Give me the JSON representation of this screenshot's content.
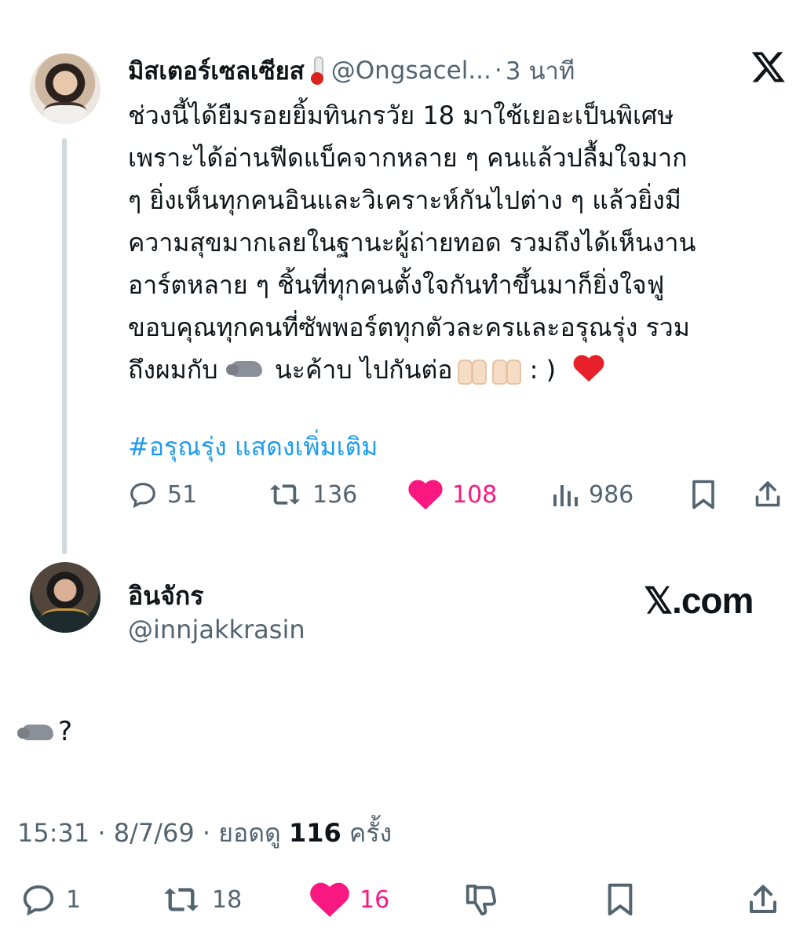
{
  "tweet": {
    "author_name": "มิสเตอร์เซลเซียส",
    "author_handle": "@Ongsacel...",
    "time_ago": "3 นาที",
    "separator": "·",
    "body_lines": [
      "ช่วงนี้ได้ยืมรอยยิ้มทินกรวัย 18 มาใช้เยอะเป็นพิเศษ",
      "เพราะได้อ่านฟีดแบ็คจากหลาย ๆ คนแล้วปลื้มใจมาก",
      "ๆ ยิ่งเห็นทุกคนอินและวิเคราะห์กันไปต่าง ๆ แล้วยิ่งมี",
      "ความสุขมากเลยในฐานะผู้ถ่ายทอด รวมถึงได้เห็นงาน",
      "อาร์ตหลาย ๆ ชิ้นที่ทุกคนตั้งใจกันทำขึ้นมาก็ยิ่งใจฟู",
      "ขอบคุณทุกคนที่ซัพพอร์ตทุกตัวละครและอรุณรุ่ง รวม"
    ],
    "last_line_a": "ถึงผมกับ",
    "last_line_b": "นะค้าบ  ไปกันต่อ",
    "last_line_c": ": )",
    "hashtag": "#อรุณรุ่ง",
    "show_more": "แสดงเพิ่มเติม",
    "replies": "51",
    "retweets": "136",
    "likes": "108",
    "views": "986",
    "like_color": "#f91880",
    "link_color": "#1d9bf0"
  },
  "reply": {
    "author_name": "อินจักร",
    "author_handle": "@innjakkrasin",
    "brand": "𝕏.com",
    "body": "?",
    "time": "15:31",
    "date": "8/7/69",
    "views_label": "ยอดดู",
    "views_count": "116",
    "views_unit": "ครั้ง",
    "separator": "·",
    "replies": "1",
    "retweets": "18",
    "likes": "16"
  }
}
